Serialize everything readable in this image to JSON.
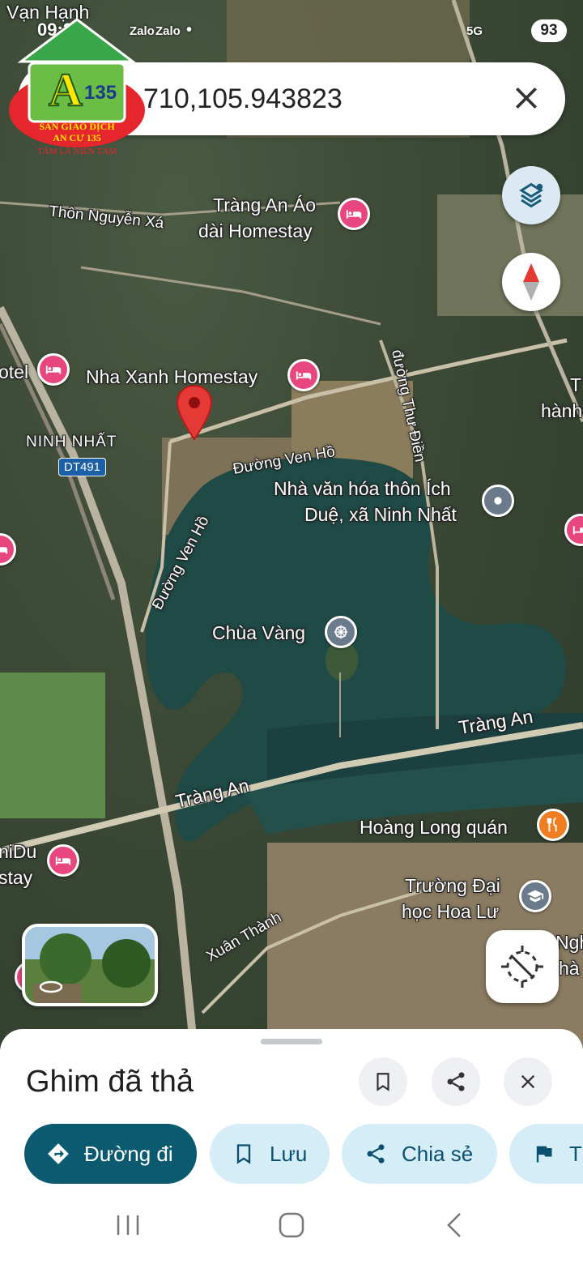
{
  "status": {
    "time": "09:2",
    "notif_labels": [
      "Zalo",
      "Zalo"
    ],
    "network": "5G",
    "battery": "93"
  },
  "search": {
    "query": "710,105.943823",
    "close_icon": "close-icon"
  },
  "logo": {
    "text": "A 135",
    "line1": "SÀN GIAO DỊCH",
    "line2": "AN CƯ 135",
    "tagline": "TÂM LÀ NIỀN TẢM"
  },
  "map": {
    "labels": {
      "van_hanh": "Vạn Hạnh",
      "thon_nguyen_xa": "Thôn Nguyễn Xá",
      "trang_an_homestay_1": "Tràng An Áo",
      "trang_an_homestay_2": "dài Homestay",
      "otel": "otel",
      "nha_xanh": "Nha Xanh Homestay",
      "ninh_nhat": "NINH NHẤT",
      "dt491": "DT491",
      "duong_thu_dien": "đường Thư Điền",
      "duong_ven_ho_1": "Đường Ven Hồ",
      "duong_ven_ho_2": "Đường Ven Hồ",
      "nha_van_hoa_1": "Nhà văn hóa thôn Ích",
      "nha_van_hoa_2": "Duệ, xã Ninh Nhất",
      "chua_vang": "Chùa Vàng",
      "trang_an_1": "Tràng An",
      "trang_an_2": "Tràng An",
      "hoang_long": "Hoàng Long quán",
      "truong_1": "Trường Đại",
      "truong_2": "học Hoa Lư",
      "xuan_thanh": "Xuân Thành",
      "nidu": "niDu",
      "stay": "stay",
      "t_edge": "T",
      "hanh_edge": "hành",
      "ngh_edge": "Ngh",
      "ha_edge": "hà"
    }
  },
  "sheet": {
    "title": "Ghim đã thả",
    "actions": {
      "directions": "Đường đi",
      "save": "Lưu",
      "share": "Chia sẻ",
      "more": "Th"
    }
  },
  "colors": {
    "primary": "#0b5a70",
    "chip_bg": "#d5edf6",
    "pin": "#e53935",
    "hotel": "#e7467f"
  }
}
